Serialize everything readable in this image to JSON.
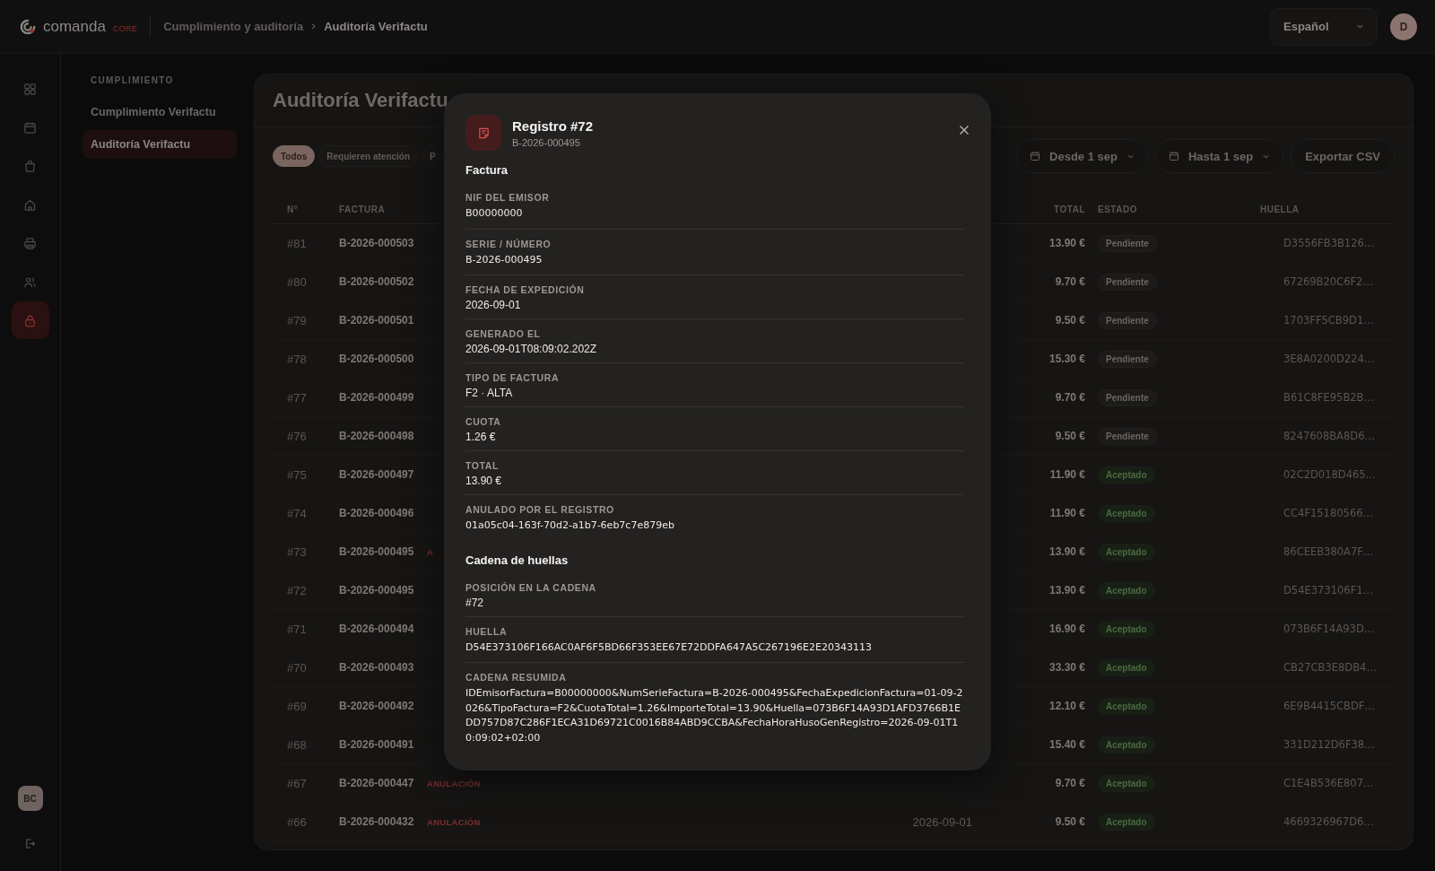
{
  "header": {
    "brand": "comanda",
    "brand_tag": "CORE",
    "breadcrumb": [
      {
        "label": "Cumplimiento y auditoría",
        "selected": false
      },
      {
        "label": "Auditoría Verifactu",
        "selected": true
      }
    ],
    "language": "Español",
    "avatar": "D"
  },
  "rail": {
    "items": [
      {
        "kind": "grid",
        "selected": false
      },
      {
        "kind": "calendar",
        "selected": false
      },
      {
        "kind": "bag",
        "selected": false
      },
      {
        "kind": "home",
        "selected": false
      },
      {
        "kind": "printer",
        "selected": false
      },
      {
        "kind": "users",
        "selected": false
      },
      {
        "kind": "lock",
        "selected": true
      }
    ],
    "user": "BC"
  },
  "sidebar": {
    "section": "CUMPLIMIENTO",
    "items": [
      {
        "label": "Cumplimiento Verifactu",
        "selected": false
      },
      {
        "label": "Auditoría Verifactu",
        "selected": true
      }
    ]
  },
  "page": {
    "title": "Auditoría Verifactu",
    "filters": [
      {
        "label": "Todos",
        "selected": true
      },
      {
        "label": "Requieren atención",
        "selected": false
      },
      {
        "label": "P",
        "selected": false
      }
    ],
    "date_from": "Desde 1 sep",
    "date_to": "Hasta 1 sep",
    "export": "Exportar CSV"
  },
  "table": {
    "columns": [
      "N°",
      "FACTURA",
      "TOTAL",
      "ESTADO",
      "HUELLA"
    ],
    "rows": [
      {
        "n": "#81",
        "factura": "B-2026-000503",
        "total": "13.90 €",
        "estado": "Pendiente",
        "kind": "pending",
        "huella": "D3556FB3B126…"
      },
      {
        "n": "#80",
        "factura": "B-2026-000502",
        "total": "9.70 €",
        "estado": "Pendiente",
        "kind": "pending",
        "huella": "67269B20C6F2…"
      },
      {
        "n": "#79",
        "factura": "B-2026-000501",
        "total": "9.50 €",
        "estado": "Pendiente",
        "kind": "pending",
        "huella": "1703FF5CB9D1…"
      },
      {
        "n": "#78",
        "factura": "B-2026-000500",
        "total": "15.30 €",
        "estado": "Pendiente",
        "kind": "pending",
        "huella": "3E8A0200D224…"
      },
      {
        "n": "#77",
        "factura": "B-2026-000499",
        "total": "9.70 €",
        "estado": "Pendiente",
        "kind": "pending",
        "huella": "B61C8FE95B2B…"
      },
      {
        "n": "#76",
        "factura": "B-2026-000498",
        "total": "9.50 €",
        "estado": "Pendiente",
        "kind": "pending",
        "huella": "8247608BA8D6…"
      },
      {
        "n": "#75",
        "factura": "B-2026-000497",
        "total": "11.90 €",
        "estado": "Aceptado",
        "kind": "accepted",
        "huella": "02C2D018D465…"
      },
      {
        "n": "#74",
        "factura": "B-2026-000496",
        "total": "11.90 €",
        "estado": "Aceptado",
        "kind": "accepted",
        "huella": "CC4F15180566…"
      },
      {
        "n": "#73",
        "factura": "B-2026-000495",
        "tag": "A",
        "total": "13.90 €",
        "estado": "Aceptado",
        "kind": "accepted",
        "huella": "86CEEB380A7F…"
      },
      {
        "n": "#72",
        "factura": "B-2026-000495",
        "total": "13.90 €",
        "estado": "Aceptado",
        "kind": "accepted",
        "huella": "D54E373106F1…"
      },
      {
        "n": "#71",
        "factura": "B-2026-000494",
        "total": "16.90 €",
        "estado": "Aceptado",
        "kind": "accepted",
        "huella": "073B6F14A93D…"
      },
      {
        "n": "#70",
        "factura": "B-2026-000493",
        "total": "33.30 €",
        "estado": "Aceptado",
        "kind": "accepted",
        "huella": "CB27CB3E8DB4…"
      },
      {
        "n": "#69",
        "factura": "B-2026-000492",
        "total": "12.10 €",
        "estado": "Aceptado",
        "kind": "accepted",
        "huella": "6E9B4415CBDF…"
      },
      {
        "n": "#68",
        "factura": "B-2026-000491",
        "total": "15.40 €",
        "estado": "Aceptado",
        "kind": "accepted",
        "huella": "331D212D6F38…"
      },
      {
        "n": "#67",
        "factura": "B-2026-000447",
        "tag": "ANULACIÓN",
        "total": "9.70 €",
        "estado": "Aceptado",
        "kind": "accepted",
        "huella": "C1E4B536E807…"
      },
      {
        "n": "#66",
        "factura": "B-2026-000432",
        "tag": "ANULACIÓN",
        "date": "2026-09-01",
        "total": "9.50 €",
        "estado": "Aceptado",
        "kind": "accepted",
        "huella": "4669326967D6…"
      }
    ]
  },
  "modal": {
    "title": "Registro #72",
    "subtitle": "B-2026-000495",
    "sections": [
      {
        "title": "Factura",
        "fields": [
          {
            "label": "NIF DEL EMISOR",
            "value": "B00000000",
            "kind": "code"
          },
          {
            "label": "SERIE / NÚMERO",
            "value": "B-2026-000495",
            "kind": "code"
          },
          {
            "label": "FECHA DE EXPEDICIÓN",
            "value": "2026-09-01",
            "kind": "text"
          },
          {
            "label": "GENERADO EL",
            "value": "2026-09-01T08:09:02.202Z",
            "kind": "text"
          },
          {
            "label": "TIPO DE FACTURA",
            "value": "F2 · ALTA",
            "kind": "text"
          },
          {
            "label": "CUOTA",
            "value": "1.26 €",
            "kind": "text"
          },
          {
            "label": "TOTAL",
            "value": "13.90 €",
            "kind": "text"
          },
          {
            "label": "ANULADO POR EL REGISTRO",
            "value": "01a05c04-163f-70d2-a1b7-6eb7c7e879eb",
            "kind": "code"
          }
        ]
      },
      {
        "title": "Cadena de huellas",
        "fields": [
          {
            "label": "POSICIÓN EN LA CADENA",
            "value": "#72",
            "kind": "text"
          },
          {
            "label": "HUELLA",
            "value": "D54E373106F166AC0AF6F5BD66F353EE67E72DDFA647A5C267196E2E20343113",
            "kind": "code"
          },
          {
            "label": "CADENA RESUMIDA",
            "value": "IDEmisorFactura=B00000000&NumSerieFactura=B-2026-000495&FechaExpedicionFactura=01-09-2026&TipoFactura=F2&CuotaTotal=1.26&ImporteTotal=13.90&Huella=073B6F14A93D1AFD3766B1EDD757D87C286F1ECA31D69721C0016B84ABD9CCBA&FechaHoraHusoGenRegistro=2026-09-01T10:09:02+02:00",
            "kind": "code"
          }
        ]
      }
    ]
  }
}
